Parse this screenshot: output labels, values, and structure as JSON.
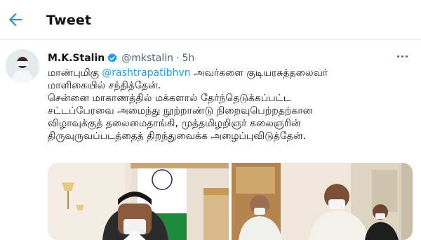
{
  "header": {
    "back_icon": "arrow-left-icon",
    "title": "Tweet"
  },
  "tweet": {
    "author": {
      "display_name": "M.K.Stalin",
      "verified_icon": "verified-badge-icon",
      "handle": "@mkstalin",
      "separator": "·",
      "time": "5h"
    },
    "more_icon": "more-horizontal-icon",
    "text": {
      "line1_pre": "மாண்புமிகு ",
      "mention": "@rashtrapatibhvn",
      "line1_post": " அவர்களை குடியரசுத்தலைவர்",
      "line2": "மாளிகையில் சந்தித்தேன்.",
      "line3": "சென்னை மாகாணத்தில் மக்களால் தேர்ந்தெடுக்கப்பட்ட",
      "line4": "சட்டப்பேரவை அமைந்து நூற்றாண்டு நிறைவுபெற்றதற்கான",
      "line5": "விழாவுக்குத் தலைமைதாங்கி, முத்தமிழறிஞர் கலைஞரின்",
      "line6": "திருவுருவப்படத்தைத் திறந்துவைக்க அழைப்புவிடுத்தேன்."
    }
  },
  "colors": {
    "accent": "#1d9bf0",
    "text": "#0f1419",
    "secondary": "#536471"
  }
}
